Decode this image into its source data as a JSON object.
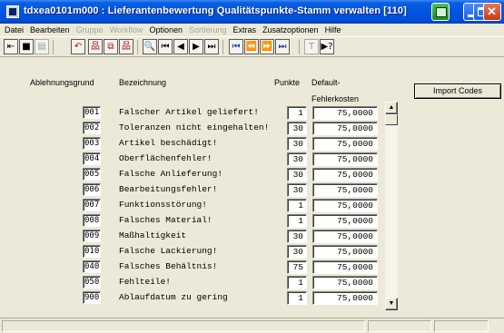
{
  "window": {
    "title": "tdxea0101m000 : Lieferantenbewertung Qualitätspunkte-Stamm verwalten [110]"
  },
  "menu": [
    {
      "label": "Datei",
      "enabled": true
    },
    {
      "label": "Bearbeiten",
      "enabled": true
    },
    {
      "label": "Gruppe",
      "enabled": false
    },
    {
      "label": "Workflow",
      "enabled": false
    },
    {
      "label": "Optionen",
      "enabled": true
    },
    {
      "label": "Sortierung",
      "enabled": false
    },
    {
      "label": "Extras",
      "enabled": true
    },
    {
      "label": "Zusatzoptionen",
      "enabled": true
    },
    {
      "label": "Hilfe",
      "enabled": true
    }
  ],
  "toolbar": {
    "icons": [
      {
        "name": "exit-icon",
        "glyph": "⇤",
        "enabled": true
      },
      {
        "name": "save-icon",
        "glyph": "■",
        "enabled": true
      },
      {
        "name": "print-icon",
        "glyph": "▤",
        "enabled": false
      },
      {
        "name": "undo-icon",
        "glyph": "↶",
        "enabled": true
      },
      {
        "name": "new-record-icon",
        "glyph": "品",
        "enabled": true
      },
      {
        "name": "copy-record-icon",
        "glyph": "⧉",
        "enabled": true
      },
      {
        "name": "delete-record-icon",
        "glyph": "品",
        "enabled": true
      },
      {
        "name": "find-icon",
        "glyph": "🔍",
        "enabled": true
      },
      {
        "name": "first-record-icon",
        "glyph": "⏮",
        "enabled": true
      },
      {
        "name": "previous-record-icon",
        "glyph": "◀",
        "enabled": true
      },
      {
        "name": "next-record-icon",
        "glyph": "▶",
        "enabled": true
      },
      {
        "name": "last-record-icon",
        "glyph": "⏭",
        "enabled": true
      },
      {
        "name": "first-set-icon",
        "glyph": "⏮",
        "enabled": true
      },
      {
        "name": "previous-set-icon",
        "glyph": "⏪",
        "enabled": true
      },
      {
        "name": "next-set-icon",
        "glyph": "⏩",
        "enabled": true
      },
      {
        "name": "last-set-icon",
        "glyph": "⏭",
        "enabled": true
      },
      {
        "name": "text-icon",
        "glyph": "T",
        "enabled": false
      },
      {
        "name": "context-help-icon",
        "glyph": "▶?",
        "enabled": true
      }
    ]
  },
  "headers": {
    "code": "Ablehnungsgrund",
    "description": "Bezeichnung",
    "points": "Punkte",
    "cost_line1": "Default-",
    "cost_line2": "Fehlerkosten"
  },
  "import_button": "Import Codes",
  "rows": [
    {
      "code": "001",
      "description": "Falscher Artikel geliefert!",
      "points": "1",
      "cost": "75,0000"
    },
    {
      "code": "002",
      "description": "Toleranzen nicht eingehalten!",
      "points": "30",
      "cost": "75,0000"
    },
    {
      "code": "003",
      "description": "Artikel beschädigt!",
      "points": "30",
      "cost": "75,0000"
    },
    {
      "code": "004",
      "description": "Oberflächenfehler!",
      "points": "30",
      "cost": "75,0000"
    },
    {
      "code": "005",
      "description": "Falsche Anlieferung!",
      "points": "30",
      "cost": "75,0000"
    },
    {
      "code": "006",
      "description": "Bearbeitungsfehler!",
      "points": "30",
      "cost": "75,0000"
    },
    {
      "code": "007",
      "description": "Funktionsstörung!",
      "points": "1",
      "cost": "75,0000"
    },
    {
      "code": "008",
      "description": "Falsches Material!",
      "points": "1",
      "cost": "75,0000"
    },
    {
      "code": "009",
      "description": "Maßhaltigkeit",
      "points": "30",
      "cost": "75,0000"
    },
    {
      "code": "010",
      "description": "Falsche Lackierung!",
      "points": "30",
      "cost": "75,0000"
    },
    {
      "code": "040",
      "description": "Falsches Behältnis!",
      "points": "75",
      "cost": "75,0000"
    },
    {
      "code": "050",
      "description": "Fehlteile!",
      "points": "1",
      "cost": "75,0000"
    },
    {
      "code": "900",
      "description": "Ablaufdatum zu gering",
      "points": "1",
      "cost": "75,0000"
    }
  ],
  "scrollbar": {
    "up_glyph": "▲",
    "down_glyph": "▼"
  },
  "colors": {
    "titlebar": "#0054e3",
    "window_bg": "#ece9d8",
    "field_bg": "#ffffff"
  }
}
